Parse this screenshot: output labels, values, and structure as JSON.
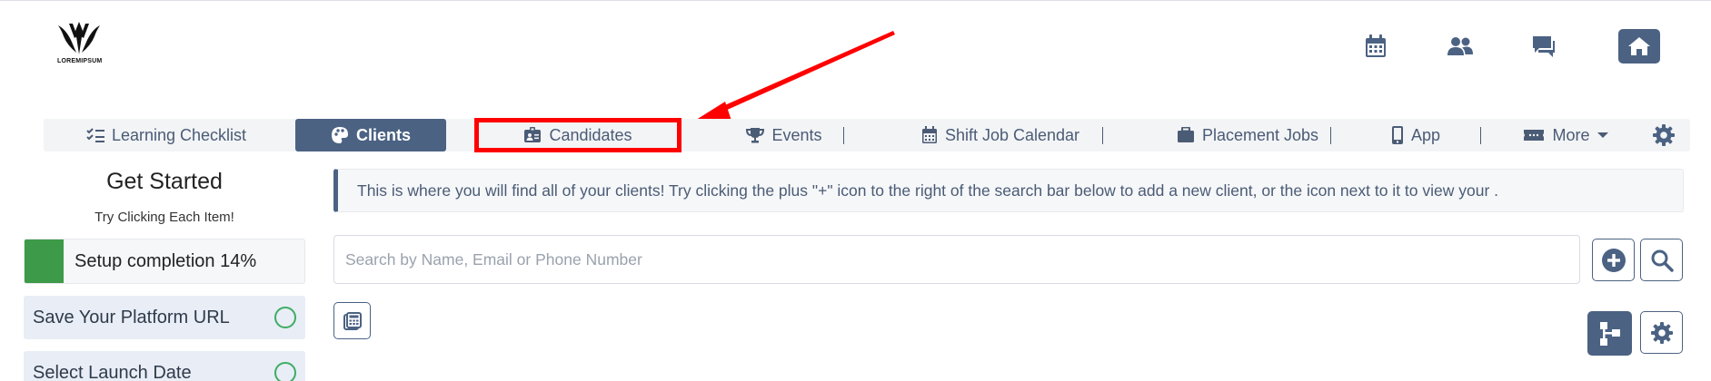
{
  "logo": {
    "text": "LOREMIPSUM"
  },
  "top_icons": [
    "calendar-icon",
    "users-icon",
    "chat-icon",
    "home-icon"
  ],
  "nav": {
    "items": [
      {
        "label": "Learning Checklist",
        "icon": "checklist-icon"
      },
      {
        "label": "Clients",
        "icon": "palette-icon",
        "active": true
      },
      {
        "label": "Candidates",
        "icon": "id-card-icon",
        "highlighted": true
      },
      {
        "label": "Events",
        "icon": "trophy-icon"
      },
      {
        "label": "Shift Job Calendar",
        "icon": "calendar-icon"
      },
      {
        "label": "Placement Jobs",
        "icon": "briefcase-icon"
      },
      {
        "label": "App",
        "icon": "mobile-icon"
      },
      {
        "label": "More",
        "icon": "ticket-icon",
        "dropdown": true
      }
    ],
    "settings_icon": "gear-icon"
  },
  "get_started": {
    "title": "Get Started",
    "subtitle": "Try Clicking Each Item!",
    "progress_label": "Setup completion 14%",
    "progress_percent": 14,
    "tasks": [
      {
        "label": "Save Your Platform URL"
      },
      {
        "label": "Select Launch Date"
      }
    ]
  },
  "main": {
    "info_text": "This is where you will find all of your clients! Try clicking the plus \"+\" icon to the right of the search bar below to add a new client, or the icon next to it to view your .",
    "search_placeholder": "Search by Name, Email or Phone Number"
  },
  "colors": {
    "primary": "#4b6283",
    "highlight": "#ff0000",
    "progress": "#3d9a48",
    "task_bg": "#e8edf6",
    "circle": "#3dad63"
  }
}
